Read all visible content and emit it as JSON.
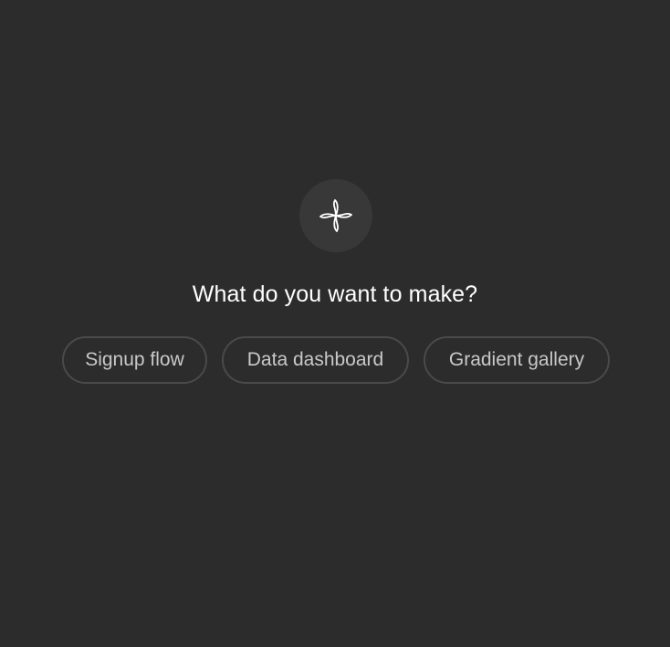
{
  "logo": {
    "icon": "sparkle-swirl-icon",
    "circle_color": "#383838",
    "stroke_color": "#ffffff"
  },
  "heading": "What do you want to make?",
  "suggestions": [
    {
      "label": "Signup flow"
    },
    {
      "label": "Data dashboard"
    },
    {
      "label": "Gradient gallery"
    }
  ],
  "colors": {
    "background": "#2c2c2c",
    "chip_border": "#4a4a4a",
    "chip_text": "#c9c9c9",
    "heading_text": "#ffffff"
  }
}
